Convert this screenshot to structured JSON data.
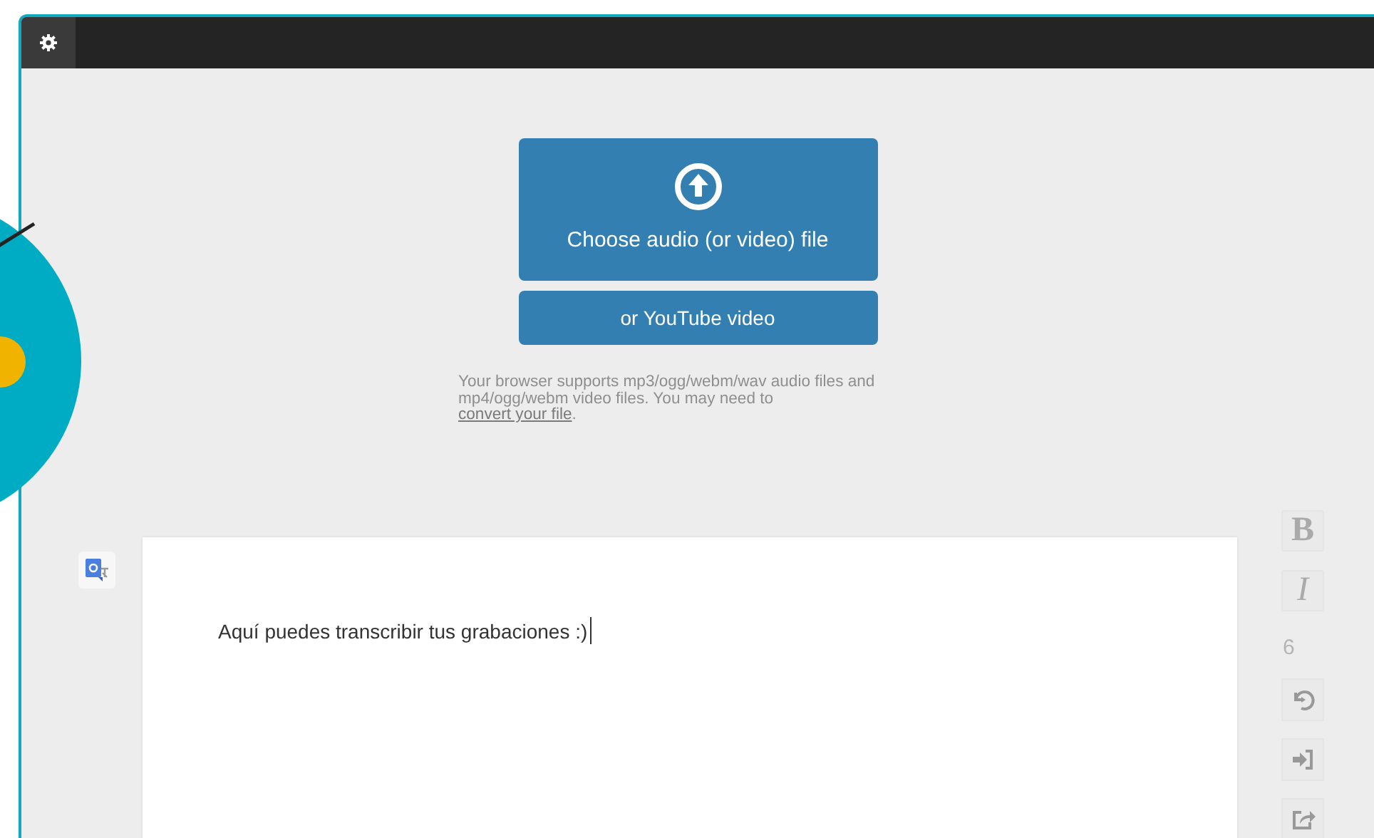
{
  "upload": {
    "choose_button": "Choose audio (or video) file",
    "youtube_button": "or YouTube video",
    "note_before": "Your browser supports mp3/ogg/webm/wav audio files and mp4/ogg/webm video files. You may need to ",
    "note_link": "convert your file",
    "note_after": "."
  },
  "editor": {
    "text": "Aquí puedes transcribir tus grabaciones :)",
    "cursor": true
  },
  "toolbar": {
    "bold": "B",
    "italic": "I",
    "word_count": "6",
    "tools": [
      {
        "kind": "rewind"
      },
      {
        "kind": "insert"
      },
      {
        "kind": "export"
      }
    ]
  }
}
